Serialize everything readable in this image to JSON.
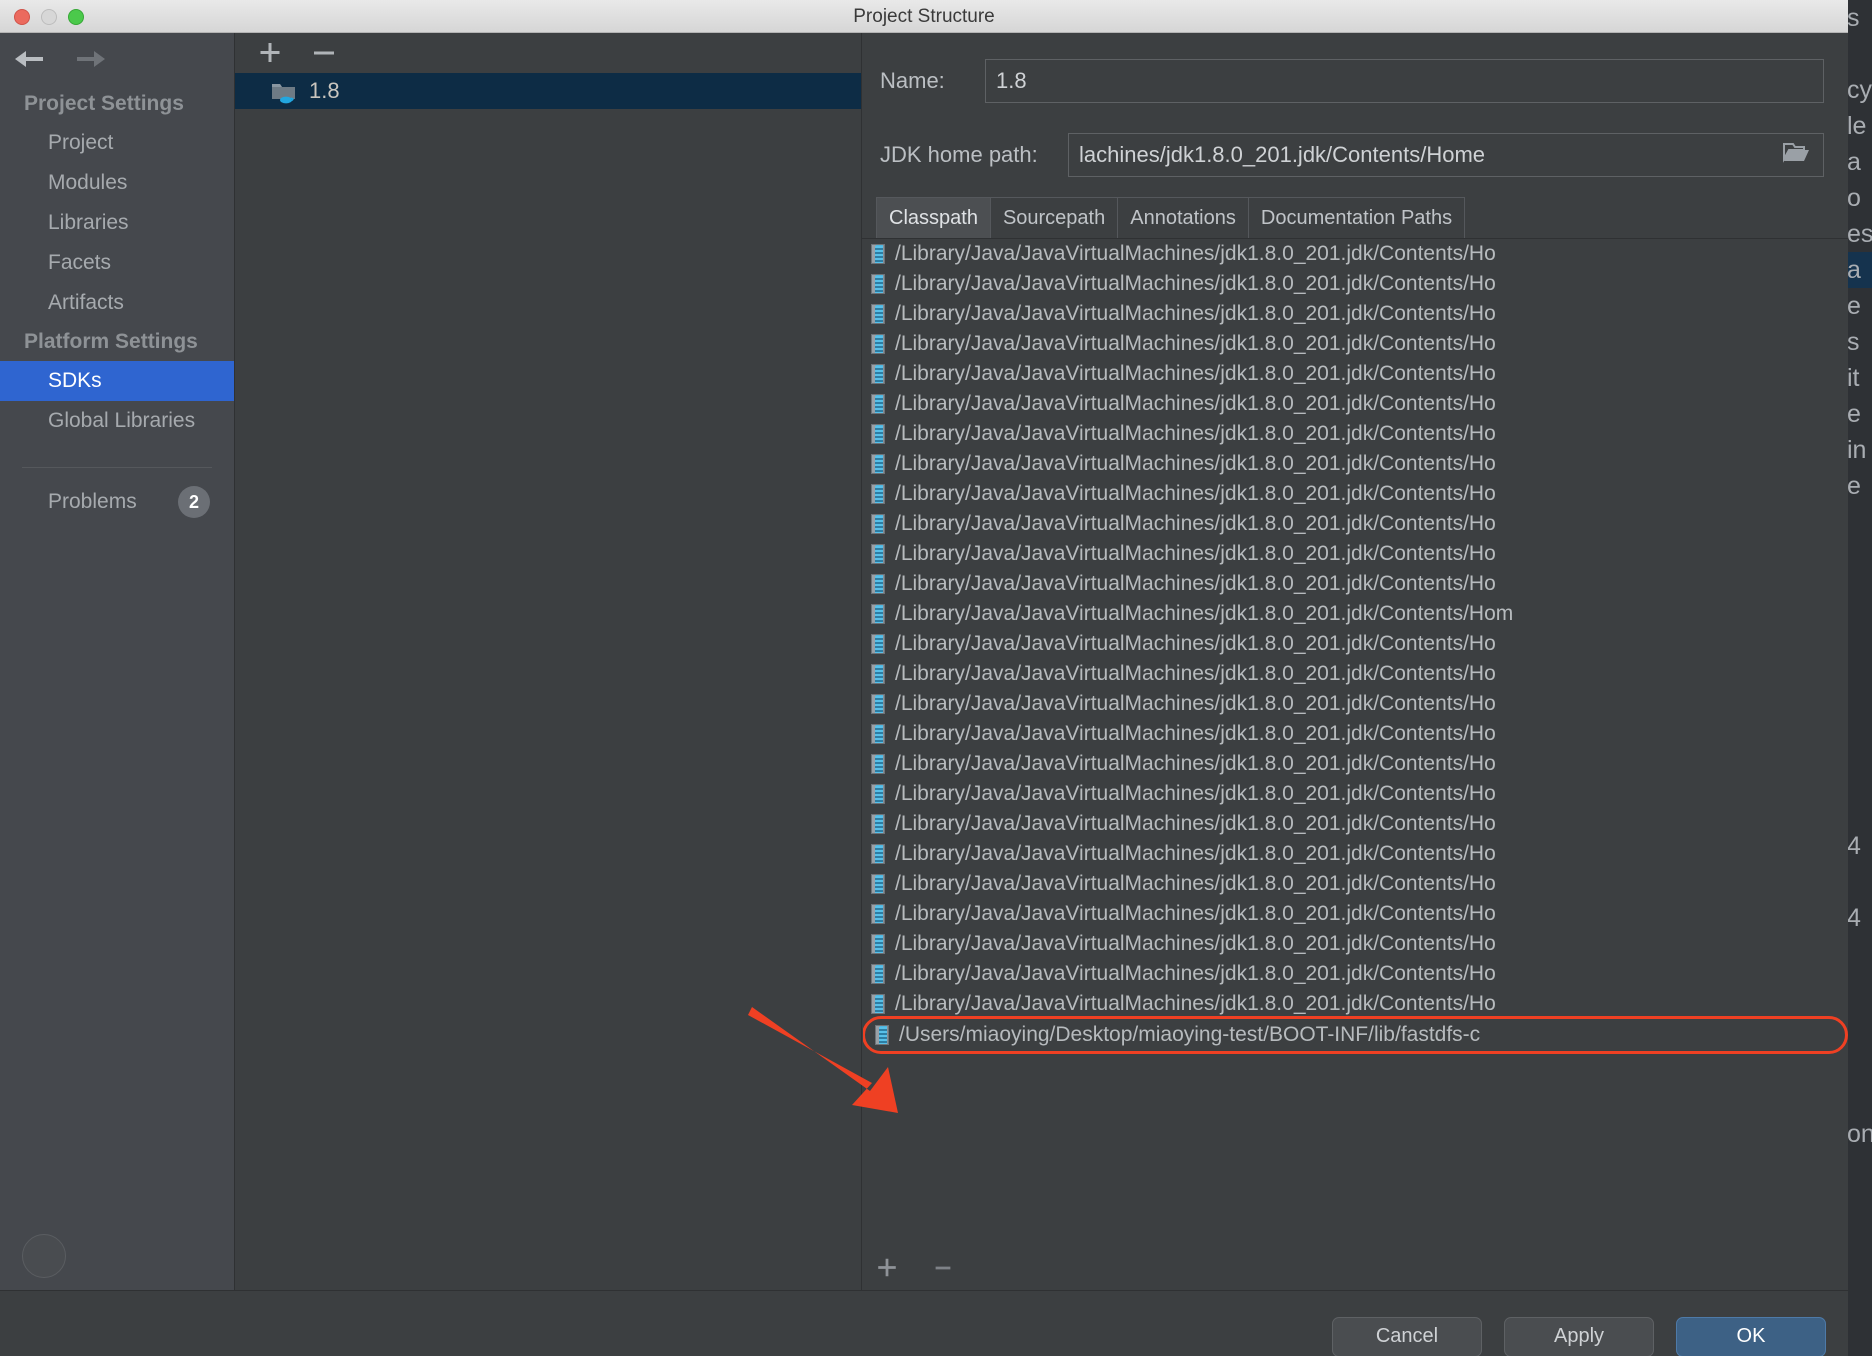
{
  "window": {
    "title": "Project Structure",
    "traffic_lights": [
      "close-red",
      "minimize-yellow",
      "zoom-green"
    ]
  },
  "sidebar": {
    "nav_back": "back-arrow",
    "nav_forward": "forward-arrow",
    "groups": [
      {
        "title": "Project Settings",
        "items": [
          {
            "label": "Project",
            "selected": false
          },
          {
            "label": "Modules",
            "selected": false
          },
          {
            "label": "Libraries",
            "selected": false
          },
          {
            "label": "Facets",
            "selected": false
          },
          {
            "label": "Artifacts",
            "selected": false
          }
        ]
      },
      {
        "title": "Platform Settings",
        "items": [
          {
            "label": "SDKs",
            "selected": true
          },
          {
            "label": "Global Libraries",
            "selected": false
          }
        ]
      }
    ],
    "problems": {
      "label": "Problems",
      "count": "2"
    },
    "help_button": "help-question-button"
  },
  "sdk_panel": {
    "add_label": "+",
    "remove_label": "−",
    "items": [
      {
        "label": "1.8",
        "selected": true,
        "icon": "jdk-folder-icon"
      }
    ]
  },
  "details": {
    "name_label": "Name:",
    "name_value": "1.8",
    "name_placeholder": "SDK name",
    "jdk_home_label": "JDK home path:",
    "jdk_home_value": "lachines/jdk1.8.0_201.jdk/Contents/Home",
    "jdk_home_placeholder": "Path to JDK home",
    "browse_icon": "folder-open-icon",
    "tabs": [
      {
        "label": "Classpath",
        "active": true
      },
      {
        "label": "Sourcepath",
        "active": false
      },
      {
        "label": "Annotations",
        "active": false
      },
      {
        "label": "Documentation Paths",
        "active": false
      }
    ],
    "classpath_rows": [
      {
        "path": "/Library/Java/JavaVirtualMachines/jdk1.8.0_201.jdk/Contents/Ho",
        "highlighted": false
      },
      {
        "path": "/Library/Java/JavaVirtualMachines/jdk1.8.0_201.jdk/Contents/Ho",
        "highlighted": false
      },
      {
        "path": "/Library/Java/JavaVirtualMachines/jdk1.8.0_201.jdk/Contents/Ho",
        "highlighted": false
      },
      {
        "path": "/Library/Java/JavaVirtualMachines/jdk1.8.0_201.jdk/Contents/Ho",
        "highlighted": false
      },
      {
        "path": "/Library/Java/JavaVirtualMachines/jdk1.8.0_201.jdk/Contents/Ho",
        "highlighted": false
      },
      {
        "path": "/Library/Java/JavaVirtualMachines/jdk1.8.0_201.jdk/Contents/Ho",
        "highlighted": false
      },
      {
        "path": "/Library/Java/JavaVirtualMachines/jdk1.8.0_201.jdk/Contents/Ho",
        "highlighted": false
      },
      {
        "path": "/Library/Java/JavaVirtualMachines/jdk1.8.0_201.jdk/Contents/Ho",
        "highlighted": false
      },
      {
        "path": "/Library/Java/JavaVirtualMachines/jdk1.8.0_201.jdk/Contents/Ho",
        "highlighted": false
      },
      {
        "path": "/Library/Java/JavaVirtualMachines/jdk1.8.0_201.jdk/Contents/Ho",
        "highlighted": false
      },
      {
        "path": "/Library/Java/JavaVirtualMachines/jdk1.8.0_201.jdk/Contents/Ho",
        "highlighted": false
      },
      {
        "path": "/Library/Java/JavaVirtualMachines/jdk1.8.0_201.jdk/Contents/Ho",
        "highlighted": false
      },
      {
        "path": "/Library/Java/JavaVirtualMachines/jdk1.8.0_201.jdk/Contents/Hom",
        "highlighted": false
      },
      {
        "path": "/Library/Java/JavaVirtualMachines/jdk1.8.0_201.jdk/Contents/Ho",
        "highlighted": false
      },
      {
        "path": "/Library/Java/JavaVirtualMachines/jdk1.8.0_201.jdk/Contents/Ho",
        "highlighted": false
      },
      {
        "path": "/Library/Java/JavaVirtualMachines/jdk1.8.0_201.jdk/Contents/Ho",
        "highlighted": false
      },
      {
        "path": "/Library/Java/JavaVirtualMachines/jdk1.8.0_201.jdk/Contents/Ho",
        "highlighted": false
      },
      {
        "path": "/Library/Java/JavaVirtualMachines/jdk1.8.0_201.jdk/Contents/Ho",
        "highlighted": false
      },
      {
        "path": "/Library/Java/JavaVirtualMachines/jdk1.8.0_201.jdk/Contents/Ho",
        "highlighted": false
      },
      {
        "path": "/Library/Java/JavaVirtualMachines/jdk1.8.0_201.jdk/Contents/Ho",
        "highlighted": false
      },
      {
        "path": "/Library/Java/JavaVirtualMachines/jdk1.8.0_201.jdk/Contents/Ho",
        "highlighted": false
      },
      {
        "path": "/Library/Java/JavaVirtualMachines/jdk1.8.0_201.jdk/Contents/Ho",
        "highlighted": false
      },
      {
        "path": "/Library/Java/JavaVirtualMachines/jdk1.8.0_201.jdk/Contents/Ho",
        "highlighted": false
      },
      {
        "path": "/Library/Java/JavaVirtualMachines/jdk1.8.0_201.jdk/Contents/Ho",
        "highlighted": false
      },
      {
        "path": "/Library/Java/JavaVirtualMachines/jdk1.8.0_201.jdk/Contents/Ho",
        "highlighted": false
      },
      {
        "path": "/Library/Java/JavaVirtualMachines/jdk1.8.0_201.jdk/Contents/Ho",
        "highlighted": false
      },
      {
        "path": "/Users/miaoying/Desktop/miaoying-test/BOOT-INF/lib/fastdfs-c",
        "highlighted": true
      }
    ],
    "classpath_add": "+",
    "classpath_remove": "−"
  },
  "footer": {
    "buttons": [
      {
        "label": "Cancel",
        "primary": false
      },
      {
        "label": "Apply",
        "primary": false
      },
      {
        "label": "OK",
        "primary": true
      }
    ]
  },
  "annotation": {
    "arrow": "red-pointer-arrow",
    "arrow_color": "#ef4023",
    "highlight_color": "#ef4023"
  },
  "background_window": {
    "visible_fragments": [
      "s",
      "",
      "cy",
      "le",
      "a",
      "o",
      "es",
      "a",
      "e",
      "s",
      "it",
      "e",
      "in",
      "e",
      "",
      "",
      "",
      "",
      "",
      "",
      "",
      "",
      "",
      "4",
      "",
      "4",
      "",
      "",
      "",
      "",
      "",
      "on"
    ]
  }
}
